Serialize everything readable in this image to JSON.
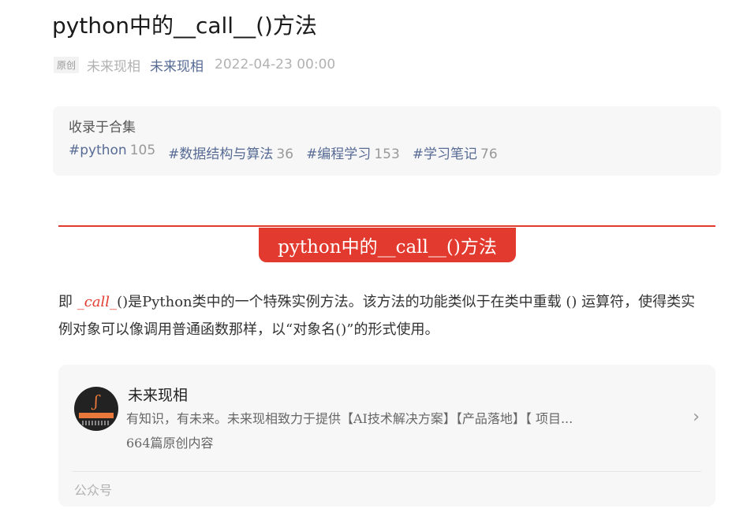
{
  "article": {
    "title_parts": [
      "python中的__",
      "call",
      "__()方法"
    ],
    "badge": "原创",
    "author_name": "未来现相",
    "account_link": "未来现相",
    "date": "2022-04-23 00:00"
  },
  "album": {
    "title": "收录于合集",
    "tags": [
      {
        "name": "#python",
        "count": "105"
      },
      {
        "name": "#数据结构与算法",
        "count": "36"
      },
      {
        "name": "#编程学习",
        "count": "153"
      },
      {
        "name": "#学习笔记",
        "count": "76"
      }
    ]
  },
  "section_heading": "python中的__call__()方法",
  "paragraph": {
    "prefix": "即 ",
    "call_name": "_call_",
    "rest": "()是Python类中的一个特殊实例方法。该方法的功能类似于在类中重载 () 运算符，使得类实例对象可以像调用普通函数那样，以“对象名()”的形式使用。"
  },
  "profile_card": {
    "name": "未来现相",
    "description": "有知识，有未来。未来现相致力于提供【AI技术解决方案】【产品落地】【 项目...",
    "count_text": "664篇原创内容",
    "footer": "公众号",
    "avatar_icon": "logo-icon",
    "chevron_icon": "chevron-right-icon"
  },
  "colors": {
    "accent_red": "#e23a2e",
    "link_blue": "#576b95"
  }
}
